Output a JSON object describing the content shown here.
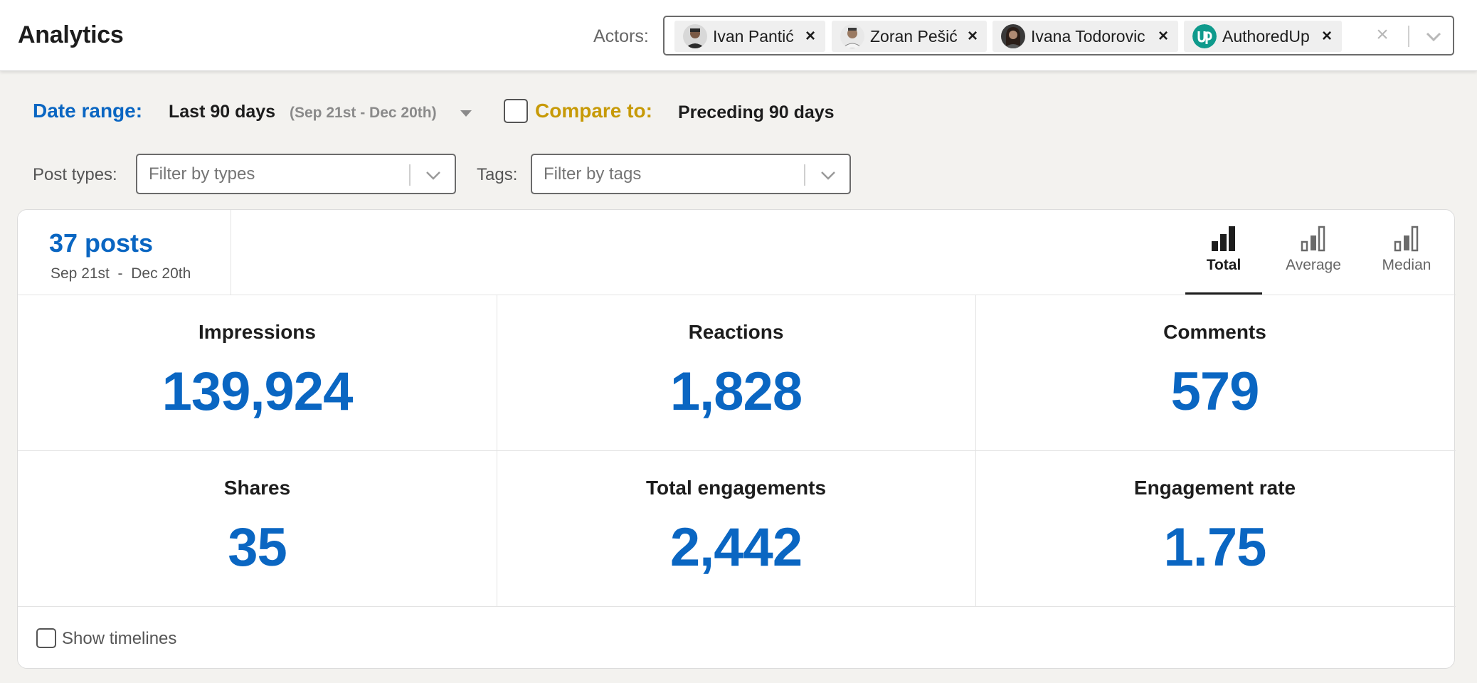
{
  "header": {
    "title": "Analytics"
  },
  "actors": {
    "label": "Actors:",
    "items": [
      {
        "name": "Ivan Pantić"
      },
      {
        "name": "Zoran Pešić"
      },
      {
        "name": "Ivana Todorovic"
      },
      {
        "name": "AuthoredUp"
      }
    ],
    "remove_glyph": "×",
    "clear_glyph": "×"
  },
  "date_range": {
    "label": "Date range:",
    "value": "Last 90 days",
    "sub": "(Sep 21st - Dec 20th)"
  },
  "compare": {
    "label": "Compare to:",
    "value": "Preceding 90 days",
    "checked": false
  },
  "filters": {
    "post_types": {
      "label": "Post types:",
      "placeholder": "Filter by types"
    },
    "tags": {
      "label": "Tags:",
      "placeholder": "Filter by tags"
    }
  },
  "summary": {
    "count": "37 posts",
    "range": "Sep 21st  -  Dec 20th"
  },
  "modes": {
    "total": "Total",
    "average": "Average",
    "median": "Median",
    "active": "Total"
  },
  "metrics": {
    "impressions": {
      "title": "Impressions",
      "value": "139,924"
    },
    "reactions": {
      "title": "Reactions",
      "value": "1,828"
    },
    "comments": {
      "title": "Comments",
      "value": "579"
    },
    "shares": {
      "title": "Shares",
      "value": "35"
    },
    "total_engagements": {
      "title": "Total engagements",
      "value": "2,442"
    },
    "engagement_rate": {
      "title": "Engagement rate",
      "value": "1.75"
    }
  },
  "timelines": {
    "label": "Show timelines",
    "checked": false
  },
  "colors": {
    "accent_blue": "#0a66c2",
    "compare_gold": "#c79a07",
    "authoredup_teal": "#0f9a8c"
  }
}
